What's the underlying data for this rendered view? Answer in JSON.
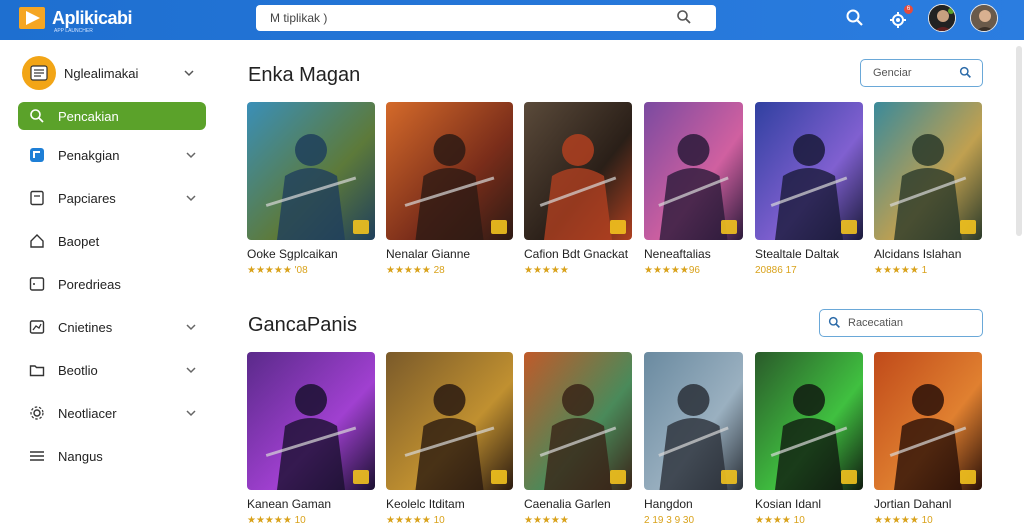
{
  "app": {
    "title": "Aplikicabi",
    "subtitle": "APP LAUNCHER",
    "search_text": "M   tiplikak   )",
    "notification_count": "6"
  },
  "sidebar": {
    "profile_name": "Nglealimakai",
    "items": [
      {
        "label": "Pencakian",
        "icon": "search-icon",
        "active": true,
        "chevron": false
      },
      {
        "label": "Penakgian",
        "icon": "app-icon",
        "active": false,
        "chevron": true
      },
      {
        "label": "Papciares",
        "icon": "document-icon",
        "active": false,
        "chevron": true
      },
      {
        "label": "Baopet",
        "icon": "home-icon",
        "active": false,
        "chevron": false
      },
      {
        "label": "Poredrieas",
        "icon": "window-icon",
        "active": false,
        "chevron": false
      },
      {
        "label": "Cnietines",
        "icon": "chart-icon",
        "active": false,
        "chevron": true
      },
      {
        "label": "Beotlio",
        "icon": "folder-icon",
        "active": false,
        "chevron": true
      },
      {
        "label": "Neotliacer",
        "icon": "gear-icon",
        "active": false,
        "chevron": true
      },
      {
        "label": "Nangus",
        "icon": "menu-icon",
        "active": false,
        "chevron": false
      }
    ]
  },
  "sections": [
    {
      "title": "Enka Magan",
      "filter_label": "Genciar",
      "games": [
        {
          "name": "Ooke Sgplcaikan",
          "meta": "★★★★★ '08",
          "colors": [
            "#3a8fb8",
            "#5d7a3a",
            "#1f3f5c"
          ]
        },
        {
          "name": "Nenalar Gianne",
          "meta": "★★★★★ 28",
          "colors": [
            "#d46a2a",
            "#7a2d1a",
            "#2d1a14"
          ]
        },
        {
          "name": "Cafion Bdt Gnackat",
          "meta": "★★★★★",
          "colors": [
            "#5a4a3a",
            "#2a1f18",
            "#b04020"
          ]
        },
        {
          "name": "Neneaftalias",
          "meta": "★★★★★96",
          "colors": [
            "#7a4aa0",
            "#d060a0",
            "#2a1a3a"
          ]
        },
        {
          "name": "Stealtale Daltak",
          "meta": "20886  17",
          "colors": [
            "#3040a0",
            "#8060d0",
            "#1a1a3a"
          ]
        },
        {
          "name": "Alcidans Islahan",
          "meta": "★★★★★ 1",
          "colors": [
            "#3a8a9a",
            "#c0a050",
            "#2a3a2a"
          ]
        }
      ]
    },
    {
      "title": "GancaPanis",
      "filter_label": "Racecatian",
      "games": [
        {
          "name": "Kanean Gaman",
          "meta": "★★★★★ 10",
          "colors": [
            "#5a2a8a",
            "#a040d0",
            "#1a1030"
          ]
        },
        {
          "name": "Keolelc Itditam",
          "meta": "★★★★★ 10",
          "colors": [
            "#7a5a2a",
            "#c09030",
            "#2a1a10"
          ]
        },
        {
          "name": "Caenalia Garlen",
          "meta": "★★★★★",
          "colors": [
            "#c05a2a",
            "#4a8a5a",
            "#3a2418"
          ]
        },
        {
          "name": "Hangdon",
          "meta": "2 19 3 9 30",
          "colors": [
            "#6a8aa0",
            "#9ab0c0",
            "#2a3038"
          ]
        },
        {
          "name": "Kosian Idanl",
          "meta": "★★★★ 10",
          "colors": [
            "#2a5a2a",
            "#40c040",
            "#101a10"
          ]
        },
        {
          "name": "Jortian Dahanl",
          "meta": "★★★★★ 10",
          "colors": [
            "#c04a1a",
            "#e08030",
            "#2a1008"
          ]
        }
      ]
    }
  ]
}
